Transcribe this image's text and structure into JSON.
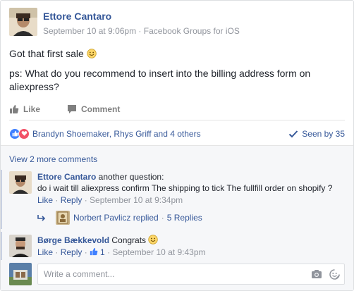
{
  "post": {
    "author": "Ettore Cantaro",
    "date": "September 10 at 9:06pm",
    "dot": " · ",
    "source": "Facebook Groups for iOS",
    "line1": "Got that first sale",
    "line2": "ps: What do you recommend to insert into the billing address form on aliexpress?"
  },
  "actions": {
    "like": "Like",
    "comment": "Comment"
  },
  "reactions": {
    "people": "Brandyn Shoemaker, Rhys Griff and 4 others",
    "seen": "Seen by 35",
    "like_color": "#4080ff",
    "love_color": "#f25268"
  },
  "comments": {
    "view_more": "View 2 more comments",
    "first": {
      "author": "Ettore Cantaro",
      "text_a": " another question:",
      "text_b": "do i wait till aliexpress confirm The shipping to tick The fullfill order on shopify ?",
      "like": "Like",
      "reply": "Reply",
      "sep": " · ",
      "time": "September 10 at 9:34pm",
      "replies_author": "Norbert Pavlicz replied",
      "replies_count": "5 Replies"
    },
    "second": {
      "author": "Børge Bækkevold",
      "text": " Congrats",
      "like": "Like",
      "reply": "Reply",
      "likes": "1",
      "sep": " · ",
      "time": "September 10 at 9:43pm"
    },
    "composer_placeholder": "Write a comment..."
  },
  "icons": {
    "like": "thumbs-up-icon",
    "comment": "speech-bubble-icon",
    "seen": "checkmark-icon",
    "reply_arrow": "reply-arrow-icon",
    "camera": "camera-icon",
    "sticker": "sticker-icon"
  }
}
